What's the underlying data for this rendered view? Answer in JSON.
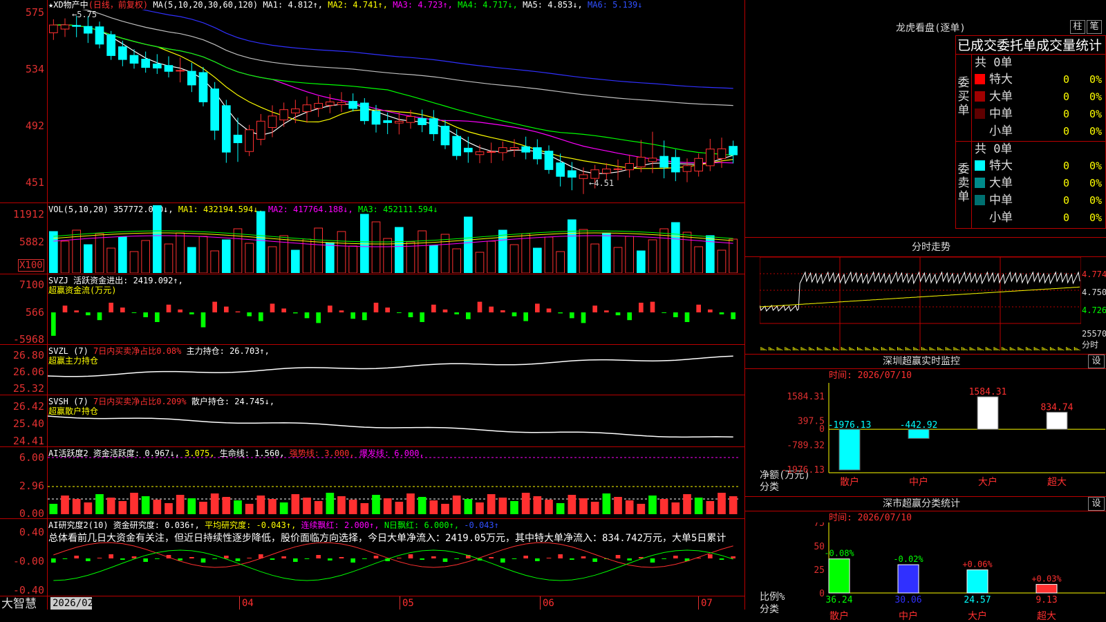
{
  "colors": {
    "up": "#ff3030",
    "down": "#00ffff",
    "ma1": "#ffffff",
    "ma2": "#ffff00",
    "ma3": "#ff00ff",
    "ma4": "#00ff00",
    "ma5": "#c0c0c0",
    "ma6": "#3030ff",
    "grid": "#b00000",
    "axis": "#e03030"
  },
  "main": {
    "star_name": "★XD物产中",
    "period": "(日线，前复权)",
    "ma_params": "MA(5,10,20,30,60,120)",
    "ma1": "MA1: 4.812↑,",
    "ma2": "MA2: 4.741↑,",
    "ma3": "MA3: 4.723↑,",
    "ma4": "MA4: 4.717↓,",
    "ma5": "MA5: 4.853↓,",
    "ma6": "MA6: 5.139↓",
    "high_label": "←5.75",
    "low_label": "←4.51",
    "yticks": [
      "575",
      "534",
      "492",
      "451"
    ]
  },
  "vol": {
    "name": "VOL(5,10,20)",
    "value": "357772.000↓,",
    "ma1": "MA1: 432194.594↓,",
    "ma2": "MA2: 417764.188↓,",
    "ma3": "MA3: 452111.594↓",
    "yticks": [
      "11912",
      "5882"
    ],
    "unit": "X100"
  },
  "svzj": {
    "title": "SVZJ  活跃资金进出: 2419.092↑,",
    "sub": "超赢资金流(万元)",
    "yticks": [
      "7100",
      "566",
      "-5968"
    ]
  },
  "svzl": {
    "title1": "SVZL (7)",
    "title2": "7日内买卖净占比0.08%",
    "title3": "主力持仓: 26.703↑,",
    "sub": "超赢主力持仓",
    "yticks": [
      "26.80",
      "26.06",
      "25.32"
    ]
  },
  "svsh": {
    "title1": "SVSH (7)",
    "title2": "7日内买卖净占比0.209%",
    "title3": "散户持仓: 24.745↓,",
    "sub": "超赢散户持仓",
    "yticks": [
      "26.42",
      "25.40",
      "24.41"
    ]
  },
  "aihy": {
    "t1": "AI活跃度2 资金活跃度: 0.967↓,",
    "t2": "3.075,",
    "t3": "生命线: 1.560,",
    "t4": "强势线: 3.000,",
    "t5": "爆发线: 6.000,",
    "yticks": [
      "6.00",
      "2.96",
      "0.00"
    ]
  },
  "aiyj": {
    "t1": "AI研究度2(10) 资金研究度: 0.036↑,",
    "t2": "平均研究度: -0.043↑,",
    "t3": "连续飘红: 2.000↑,",
    "t4": "N日飘红: 6.000↑,",
    "t5": "-0.043↑",
    "summary": "总体看前几日大资金有关注，但近日持续性逐步降低，股价面临方向选择，今日大单净流入：2419.05万元，其中特大单净流入：834.742万元，大单5日累计",
    "yticks": [
      "0.40",
      "-0.00",
      "-0.40"
    ]
  },
  "xaxis": {
    "brand": "大智慧",
    "labels": [
      "2026/02",
      "04",
      "05",
      "06",
      "07"
    ]
  },
  "dragon": {
    "title": "龙虎看盘(逐单)",
    "btn1": "柱",
    "btn2": "笔",
    "heading": "已成交委托单成交量统计",
    "buy": {
      "label": "委买单",
      "total": "共 0单",
      "rows": [
        {
          "name": "特大",
          "v": "0",
          "p": "0%",
          "color": "#ff0000"
        },
        {
          "name": "大单",
          "v": "0",
          "p": "0%",
          "color": "#a00000"
        },
        {
          "name": "中单",
          "v": "0",
          "p": "0%",
          "color": "#600000"
        },
        {
          "name": "小单",
          "v": "0",
          "p": "0%",
          "color": ""
        }
      ]
    },
    "sell": {
      "label": "委卖单",
      "total": "共 0单",
      "rows": [
        {
          "name": "特大",
          "v": "0",
          "p": "0%",
          "color": "#00ffff"
        },
        {
          "name": "大单",
          "v": "0",
          "p": "0%",
          "color": "#008b8b"
        },
        {
          "name": "中单",
          "v": "0",
          "p": "0%",
          "color": "#007070"
        },
        {
          "name": "小单",
          "v": "0",
          "p": "0%",
          "color": ""
        }
      ]
    }
  },
  "minute": {
    "title": "分时走势",
    "yticks": [
      "4.774",
      "4.750",
      "4.726"
    ],
    "vol": "25570",
    "vol_unit": "分时"
  },
  "szrt": {
    "title": "深圳超赢实时监控",
    "btn": "设",
    "time": "时间: 2026/07/10",
    "yticks": [
      "1584.31",
      "397.5",
      "0",
      "-789.32",
      "-1976.13"
    ],
    "ylabel": "净额(万元)",
    "xlabel": "分类",
    "cats": [
      "散户",
      "中户",
      "大户",
      "超大"
    ],
    "values": [
      "-1976.13",
      "-442.92",
      "1584.31",
      "834.74"
    ]
  },
  "szcls": {
    "title": "深市超赢分类统计",
    "btn": "设",
    "time": "时间: 2026/07/10",
    "yticks": [
      "75",
      "50",
      "25",
      "0"
    ],
    "ylabel": "比例%",
    "xlabel": "分类",
    "cats": [
      "散户",
      "中户",
      "大户",
      "超大"
    ],
    "values": [
      "36.24",
      "30.06",
      "24.57",
      "9.13"
    ],
    "changes": [
      "-0.08%",
      "-0.02%",
      "+0.06%",
      "+0.03%"
    ]
  },
  "chart_data": [
    {
      "type": "candlestick",
      "title": "XD物产中 日线 前复权",
      "x": [
        "2026/02",
        "04",
        "05",
        "06",
        "07"
      ],
      "ylim": [
        4.45,
        5.8
      ],
      "high": 5.75,
      "low": 4.51,
      "ohlc_approx": [
        [
          5.65,
          5.72,
          5.6,
          5.68
        ],
        [
          5.68,
          5.75,
          5.62,
          5.7
        ],
        [
          5.7,
          5.74,
          5.55,
          5.58
        ],
        [
          5.58,
          5.6,
          5.42,
          5.45
        ],
        [
          5.45,
          5.5,
          5.38,
          5.42
        ],
        [
          5.42,
          5.48,
          5.35,
          5.38
        ],
        [
          5.38,
          5.45,
          5.3,
          5.36
        ],
        [
          5.36,
          5.4,
          5.15,
          5.18
        ],
        [
          5.18,
          5.2,
          4.72,
          4.78
        ],
        [
          4.78,
          4.95,
          4.75,
          4.92
        ],
        [
          4.92,
          5.1,
          4.88,
          5.05
        ],
        [
          5.05,
          5.15,
          5.0,
          5.1
        ],
        [
          5.1,
          5.18,
          5.02,
          5.12
        ],
        [
          5.12,
          5.2,
          5.08,
          5.16
        ],
        [
          5.16,
          5.22,
          5.1,
          5.12
        ],
        [
          5.12,
          5.14,
          4.95,
          4.98
        ],
        [
          4.98,
          5.05,
          4.92,
          5.02
        ],
        [
          5.02,
          5.1,
          4.98,
          5.05
        ],
        [
          5.05,
          5.08,
          4.88,
          4.9
        ],
        [
          4.9,
          4.95,
          4.75,
          4.78
        ],
        [
          4.78,
          4.85,
          4.72,
          4.8
        ],
        [
          4.8,
          4.86,
          4.74,
          4.82
        ],
        [
          4.82,
          4.9,
          4.78,
          4.84
        ],
        [
          4.84,
          4.88,
          4.7,
          4.72
        ],
        [
          4.72,
          4.76,
          4.55,
          4.6
        ],
        [
          4.6,
          4.68,
          4.51,
          4.65
        ],
        [
          4.65,
          4.72,
          4.6,
          4.68
        ],
        [
          4.68,
          4.75,
          4.62,
          4.7
        ],
        [
          4.7,
          4.95,
          4.68,
          4.8
        ],
        [
          4.8,
          4.85,
          4.6,
          4.65
        ],
        [
          4.65,
          4.72,
          4.6,
          4.7
        ],
        [
          4.7,
          4.9,
          4.68,
          4.84
        ],
        [
          4.84,
          4.88,
          4.72,
          4.78
        ]
      ]
    },
    {
      "type": "bar",
      "title": "VOL(5,10,20)",
      "values_x100": [
        357772
      ],
      "ma": [
        432194.594,
        417764.188,
        452111.594
      ]
    },
    {
      "type": "bar",
      "title": "深圳超赢实时监控",
      "categories": [
        "散户",
        "中户",
        "大户",
        "超大"
      ],
      "values": [
        -1976.13,
        -442.92,
        1584.31,
        834.74
      ],
      "ylabel": "净额(万元)"
    },
    {
      "type": "bar",
      "title": "深市超赢分类统计",
      "categories": [
        "散户",
        "中户",
        "大户",
        "超大"
      ],
      "values": [
        36.24,
        30.06,
        24.57,
        9.13
      ],
      "ylabel": "比例%",
      "ylim": [
        0,
        75
      ]
    }
  ]
}
